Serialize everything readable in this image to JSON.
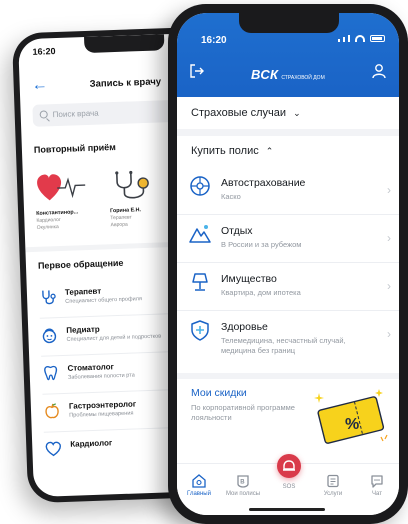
{
  "back_phone": {
    "status_time": "16:20",
    "nav_title": "Запись к врачу",
    "search_placeholder": "Поиск врача",
    "repeat_section": "Повторный приём",
    "doctors": [
      {
        "name": "Константинор...",
        "specialty": "Кардиолог",
        "clinic": "Окулинка",
        "icon": "heart-pulse-icon"
      },
      {
        "name": "Горина Е.Н.",
        "specialty": "Терапевт",
        "clinic": "Аврора",
        "icon": "stethoscope-icon"
      }
    ],
    "first_section": "Первое обращение",
    "specialists": [
      {
        "name": "Терапевт",
        "desc": "Специалист общего профиля",
        "icon": "stethoscope-icon"
      },
      {
        "name": "Педиатр",
        "desc": "Специалист для детей и подростков",
        "icon": "child-face-icon"
      },
      {
        "name": "Стоматолог",
        "desc": "Заболевания полости рта",
        "icon": "tooth-icon"
      },
      {
        "name": "Гастроэнтеролог",
        "desc": "Проблемы пищеварения",
        "icon": "apple-icon"
      },
      {
        "name": "Кардиолог",
        "desc": "",
        "icon": "heart-icon"
      }
    ]
  },
  "front_phone": {
    "status_time": "16:20",
    "logo_text": "ВСК",
    "logo_sub": "СТРАХОВОЙ ДОМ",
    "insurance_cases": "Страховые случаи",
    "buy_policy": "Купить полис",
    "policies": [
      {
        "title": "Автострахование",
        "subtitle": "Каско",
        "icon": "wheel-icon"
      },
      {
        "title": "Отдых",
        "subtitle": "В России и за рубежом",
        "icon": "mountain-icon"
      },
      {
        "title": "Имущество",
        "subtitle": "Квартира, дом ипотека",
        "icon": "lamp-icon"
      },
      {
        "title": "Здоровье",
        "subtitle": "Телемедицина, несчастный случай, медицина без границ",
        "icon": "shield-plus-icon"
      }
    ],
    "discounts_title": "Мои скидки",
    "discounts_subtitle": "По корпоративной программе лояльности",
    "coupon_label": "%",
    "tabs": [
      {
        "label": "Главный",
        "icon": "home-icon",
        "active": true
      },
      {
        "label": "Мои полисы",
        "icon": "policy-icon",
        "active": false
      },
      {
        "label": "SOS",
        "icon": "sos-icon",
        "active": false
      },
      {
        "label": "Услуги",
        "icon": "services-icon",
        "active": false
      },
      {
        "label": "Чат",
        "icon": "chat-icon",
        "active": false
      }
    ],
    "colors": {
      "brand": "#1a63c6",
      "sos": "#d93a4a",
      "coupon": "#f7d21c"
    }
  }
}
